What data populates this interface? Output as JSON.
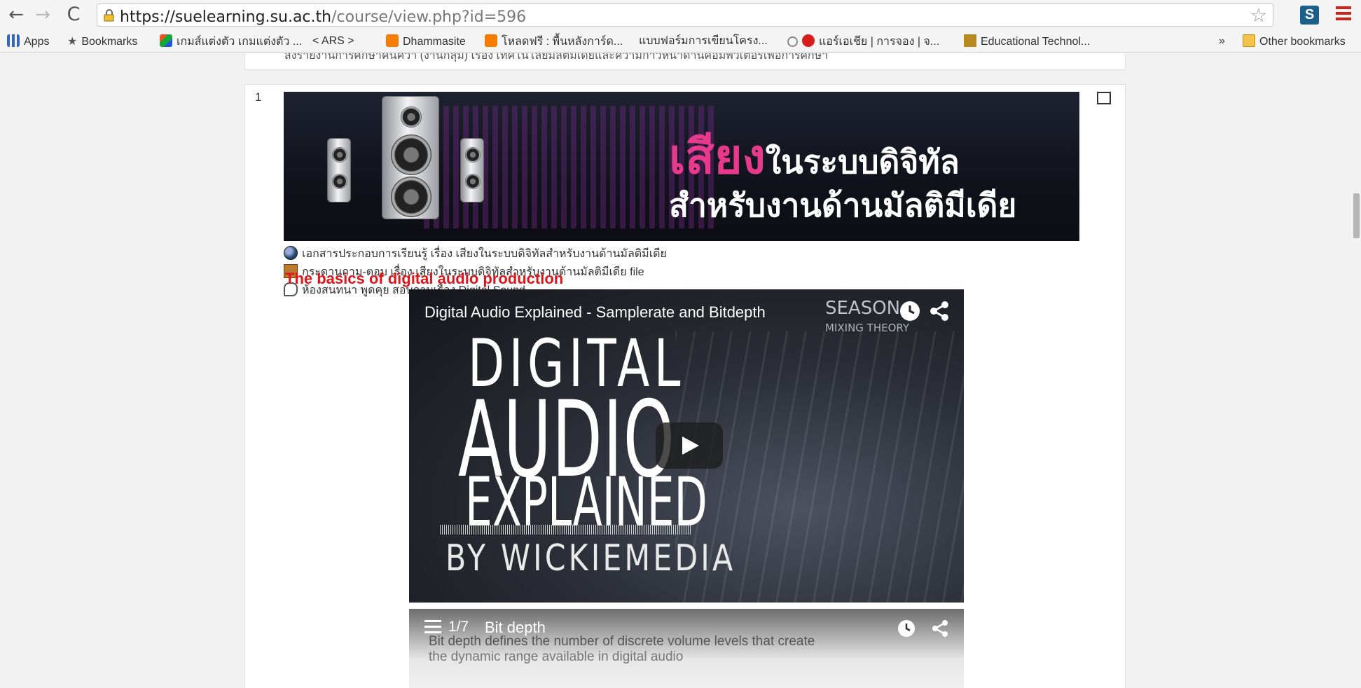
{
  "browser": {
    "url_host": "https://suelearning.su.ac.th",
    "url_path": "/course/view.php?id=596",
    "bookmarks": [
      {
        "label": "Apps",
        "icon": "apps-icon"
      },
      {
        "label": "Bookmarks",
        "icon": "star-icon"
      },
      {
        "label": "เกมส์แต่งตัว เกมแต่งตัว ...",
        "icon": "multicolor-icon"
      },
      {
        "label": "< ARS >",
        "icon": "page-icon"
      },
      {
        "label": "Dhammasite",
        "icon": "blogger-icon"
      },
      {
        "label": "โหลดฟรี : พื้นหลังการ์ด...",
        "icon": "blogger-icon"
      },
      {
        "label": "แบบฟอร์มการเขียนโครง...",
        "icon": "page-icon"
      },
      {
        "label": "แอร์เอเชีย | การจอง | จ...",
        "icon": "airasia-icon"
      },
      {
        "label": "Educational Technol...",
        "icon": "edu-icon"
      }
    ],
    "overflow_label": "»",
    "other_bookmarks": "Other bookmarks"
  },
  "page": {
    "prev_item_text": "ส่งรายงานการศึกษาค้นคว้า (งานกลุ่ม) เรื่อง เทคโนโลยีมัลติมีเดียและความก้าวหน้าด้านคอมพิวเตอร์เพื่อการศึกษา",
    "section_number": "1",
    "banner": {
      "title_highlight": "เสียง",
      "title_rest": "ในระบบดิจิทัล",
      "subtitle": "สำหรับงานด้านมัลติมีเดีย"
    },
    "resources": [
      "เอกสารประกอบการเรียนรู้ เรื่อง เสียงในระบบดิจิทัลสำหรับงานด้านมัลติมีเดีย",
      "กระดานถาม-ตอบ เรื่อง เสียงในระบบดิจิทัลสำหรับงานด้านมัลติมีเดีย file",
      "ห้องสนทนา พูดคุย สอบถามเรื่อง Digital Sound"
    ],
    "red_heading": "The basics of digital audio production",
    "video1": {
      "title": "Digital Audio Explained - Samplerate and Bitdepth",
      "channel": "SEASON",
      "channel_sub": "MIXING THEORY",
      "line1": "DIGITAL",
      "line2": "AUDIO",
      "line3": "EXPLAINED",
      "line4": "BY WICKIEMEDIA"
    },
    "video2": {
      "counter": "1/7",
      "title": "Bit depth",
      "under1": "Bit depth defines the number of discrete volume levels that create",
      "under2": "the dynamic range available in digital audio"
    }
  }
}
